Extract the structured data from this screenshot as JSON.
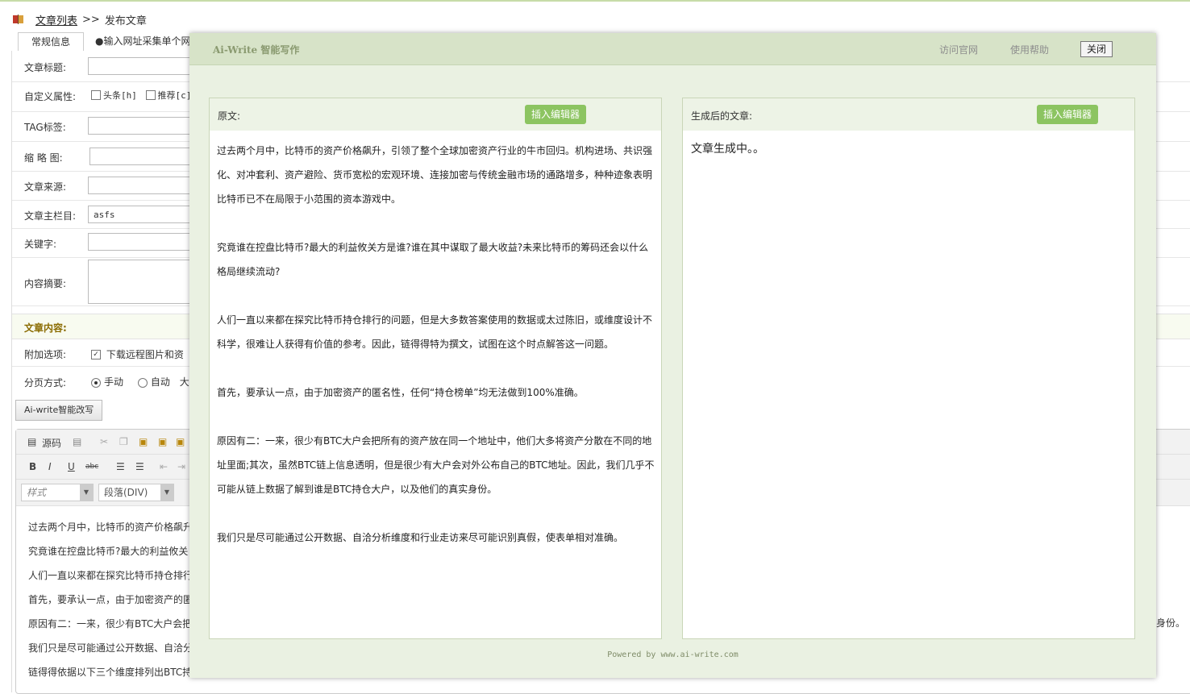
{
  "breadcrumb": {
    "link": "文章列表",
    "sep": ">>",
    "current": "发布文章"
  },
  "tabs": [
    "常规信息",
    "●输入网址采集单个网"
  ],
  "form": {
    "title_label": "文章标题:",
    "attr_label": "自定义属性:",
    "attr_options": [
      "头条[h]",
      "推荐[c]"
    ],
    "tag_label": "TAG标签:",
    "thumb_label": "缩 略 图:",
    "source_label": "文章来源:",
    "category_label": "文章主栏目:",
    "category_value": "asfs",
    "keywords_label": "关键字:",
    "summary_label": "内容摘要:",
    "content_section": "文章内容:",
    "extra_label": "附加选项:",
    "extra_option": "下载远程图片和资",
    "paging_label": "分页方式:",
    "paging_options": [
      "手动",
      "自动",
      "大"
    ],
    "ai_button": "Ai-write智能改写"
  },
  "editor": {
    "toolbar_source": "源码",
    "style_placeholder": "样式",
    "format_value": "段落(DIV)",
    "lines": [
      "过去两个月中，比特币的资产价格飙升",
      "究竟谁在控盘比特币?最大的利益攸关",
      "人们一直以来都在探究比特币持仓排行",
      "首先，要承认一点，由于加密资产的匿",
      "原因有二：一来，很少有BTC大户会把",
      "我们只是尽可能通过公开数据、自洽分",
      "链得得依据以下三个维度排列出BTC持"
    ],
    "tail": "身份。"
  },
  "modal": {
    "title": "Ai-Write 智能写作",
    "link_site": "访问官网",
    "link_help": "使用帮助",
    "close": "关闭",
    "left_label": "原文:",
    "insert_button": "插入编辑器",
    "right_label": "生成后的文章:",
    "insert_button_right": "插入编辑器",
    "original_paragraphs": [
      "过去两个月中，比特币的资产价格飙升，引领了整个全球加密资产行业的牛市回归。机构进场、共识强化、对冲套利、资产避险、货币宽松的宏观环境、连接加密与传统金融市场的通路增多，种种迹象表明比特币已不在局限于小范围的资本游戏中。",
      "究竟谁在控盘比特币?最大的利益攸关方是谁?谁在其中谋取了最大收益?未来比特币的筹码还会以什么格局继续流动?",
      "人们一直以来都在探究比特币持仓排行的问题，但是大多数答案使用的数据或太过陈旧，或维度设计不科学，很难让人获得有价值的参考。因此，链得得特为撰文，试图在这个时点解答这一问题。",
      "首先，要承认一点，由于加密资产的匿名性，任何“持仓榜单”均无法做到100%准确。",
      "原因有二：一来，很少有BTC大户会把所有的资产放在同一个地址中，他们大多将资产分散在不同的地址里面;其次，虽然BTC链上信息透明，但是很少有大户会对外公布自己的BTC地址。因此，我们几乎不可能从链上数据了解到谁是BTC持仓大户，以及他们的真实身份。",
      "我们只是尽可能通过公开数据、自洽分析维度和行业走访来尽可能识别真假，使表单相对准确。"
    ],
    "generated_text": "文章生成中。。",
    "powered": "Powered by www.ai-write.com"
  }
}
